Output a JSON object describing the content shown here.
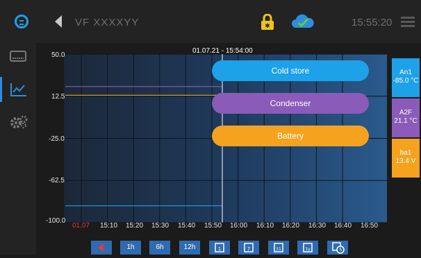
{
  "header": {
    "device_title": "VF XXXXYY",
    "clock": "15:55:20",
    "icons": [
      "logo-icon",
      "back-arrow-icon",
      "lock-icon",
      "cloud-check-icon",
      "menu-icon"
    ],
    "colors": {
      "lock": "#f0c419",
      "cloud": "#2f8de0",
      "check": "#5fcf3a"
    }
  },
  "sidebar": {
    "items": [
      {
        "name": "display",
        "icon": "display-icon"
      },
      {
        "name": "chart",
        "icon": "line-chart-icon",
        "active": true
      },
      {
        "name": "settings",
        "icon": "gears-icon"
      }
    ]
  },
  "chart": {
    "cursor_time": "01.07.21 - 15:54:00",
    "y_ticks": [
      "50.0",
      "12.5",
      "-25.0",
      "-62.5",
      "-100.0"
    ],
    "x_date": "01.07",
    "x_ticks": [
      "15:10",
      "15:20",
      "15:30",
      "15:40",
      "15:50",
      "16:00",
      "16:10",
      "16:20",
      "16:30",
      "16:40",
      "16:50"
    ],
    "legend": [
      {
        "label": "Cold store",
        "color": "#1da1e8"
      },
      {
        "label": "Condenser",
        "color": "#8a5bb8"
      },
      {
        "label": "Battery",
        "color": "#f5a21e"
      }
    ]
  },
  "chart_data": {
    "type": "line",
    "ylim": [
      -100,
      50
    ],
    "x_ticks": [
      "15:10",
      "15:20",
      "15:30",
      "15:40",
      "15:50",
      "16:00",
      "16:10",
      "16:20",
      "16:30",
      "16:40",
      "16:50"
    ],
    "series": [
      {
        "name": "Cold store",
        "color": "#1da1e8",
        "values": [
          -85,
          -85,
          -85,
          -85,
          -85
        ]
      },
      {
        "name": "Condenser",
        "color": "#8a5bb8",
        "values": [
          21.1,
          21.1,
          21.1,
          21.1,
          21.1
        ]
      },
      {
        "name": "Battery",
        "color": "#f5a21e",
        "values": [
          13.4,
          13.4,
          13.4,
          13.4,
          13.4
        ]
      }
    ],
    "grid": true
  },
  "side_tags": [
    {
      "label": "An1",
      "value": "-85.0 °C",
      "color": "#1da1e8"
    },
    {
      "label": "A2F",
      "value": "21.1 °C",
      "color": "#8a5bb8"
    },
    {
      "label": "ba1",
      "value": "13.4 V",
      "color": "#f5a21e"
    }
  ],
  "toolbar": {
    "buttons": [
      {
        "label": "",
        "icon": "back-red-icon"
      },
      {
        "label": "1h"
      },
      {
        "label": "6h"
      },
      {
        "label": "12h"
      },
      {
        "label": "",
        "icon": "calendar-1-icon"
      },
      {
        "label": "",
        "icon": "calendar-7-icon"
      },
      {
        "label": "",
        "icon": "calendar-31-icon"
      },
      {
        "label": "",
        "icon": "calendar-1y-icon"
      },
      {
        "label": "",
        "icon": "calendar-clock-icon"
      }
    ]
  }
}
